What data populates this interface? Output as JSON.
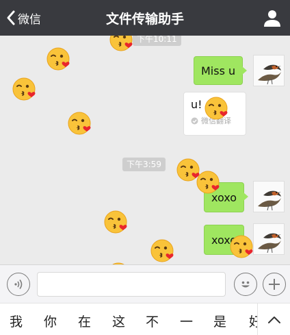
{
  "header": {
    "back_label": "微信",
    "title": "文件传输助手"
  },
  "chat": {
    "timestamps": [
      "下午10:11",
      "下午3:59"
    ],
    "messages": [
      {
        "text": "Miss u"
      },
      {
        "text": "u!",
        "translation_label": "微信翻译"
      },
      {
        "text": "xoxo"
      },
      {
        "text": "xoxo"
      }
    ]
  },
  "input": {
    "value": "",
    "placeholder": ""
  },
  "ime": {
    "candidates": [
      "我",
      "你",
      "在",
      "这",
      "不",
      "一",
      "是",
      "好"
    ]
  },
  "icons": {
    "back": "chevron-left-icon",
    "user": "person-icon",
    "voice": "voice-icon",
    "emoji": "smiley-icon",
    "plus": "plus-icon",
    "expand": "chevron-up-icon",
    "avatar": "bird-avatar",
    "overlay": "kissing-face-emoji"
  },
  "colors": {
    "navbar": "#393a3f",
    "bubble_green": "#9fe660",
    "background": "#ebebeb"
  }
}
